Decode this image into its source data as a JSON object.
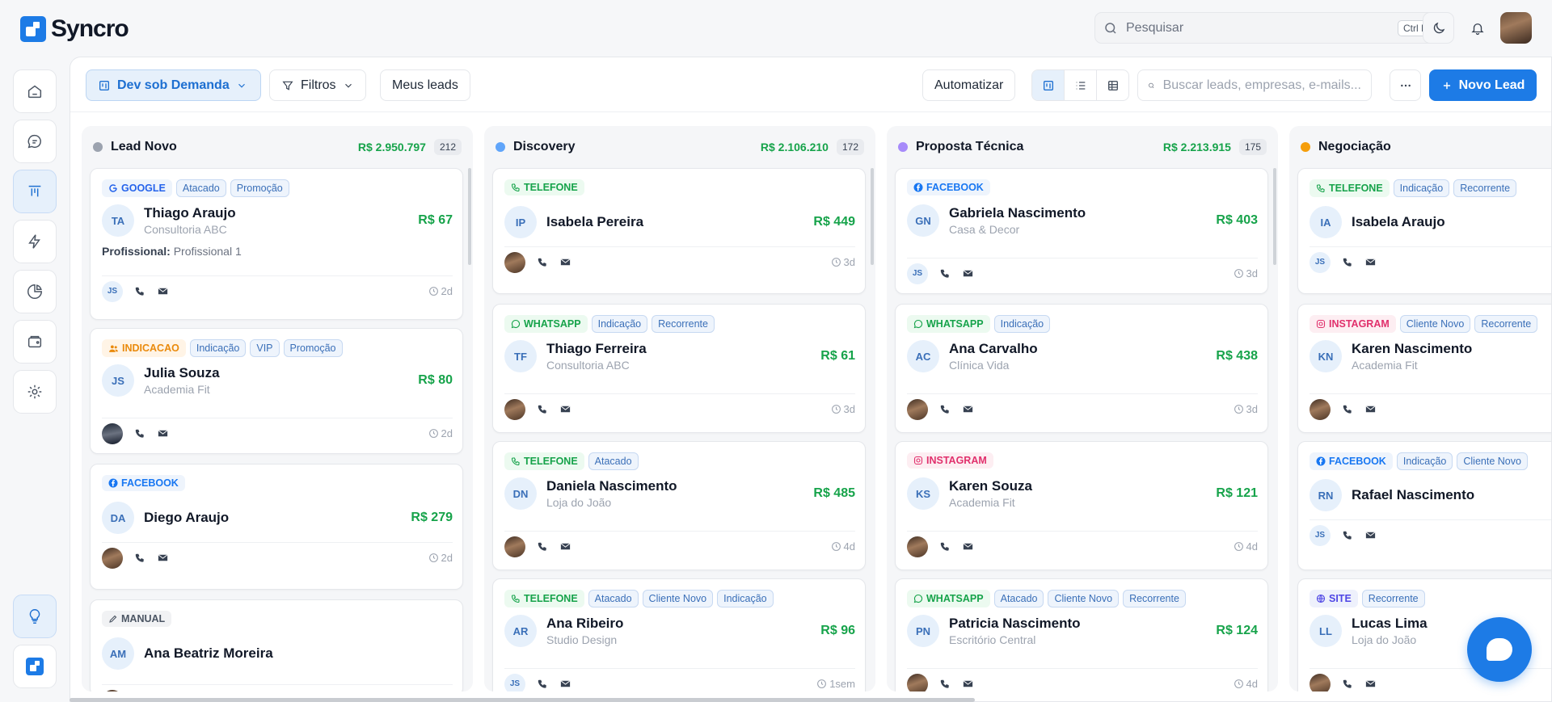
{
  "app": {
    "name": "Syncro"
  },
  "topbar": {
    "search_placeholder": "Pesquisar",
    "shortcut": "Ctrl K"
  },
  "toolbar": {
    "pipeline": "Dev sob Demanda",
    "filters": "Filtros",
    "my_leads": "Meus leads",
    "automate": "Automatizar",
    "search_placeholder": "Buscar leads, empresas, e-mails...",
    "new_lead": "Novo Lead"
  },
  "colors": {
    "accent": "#1d7be6",
    "money": "#16a34a"
  },
  "columns": [
    {
      "title": "Lead Novo",
      "total": "R$ 2.950.797",
      "count": "212",
      "dot": "#9ca3af",
      "cards": [
        {
          "source": "GOOGLE",
          "src_class": "google",
          "tags": [
            "Atacado",
            "Promoção"
          ],
          "initials": "TA",
          "name": "Thiago Araujo",
          "company": "Consultoria ABC",
          "value": "R$ 67",
          "extra_label": "Profissional:",
          "extra_value": "Profissional 1",
          "owner": "JS",
          "ago": "2d"
        },
        {
          "source": "INDICACAO",
          "src_class": "indicacao",
          "tags": [
            "Indicação",
            "VIP",
            "Promoção"
          ],
          "initials": "JS",
          "name": "Julia Souza",
          "company": "Academia Fit",
          "value": "R$ 80",
          "owner": "",
          "ago": "2d"
        },
        {
          "source": "FACEBOOK",
          "src_class": "facebook",
          "tags": [],
          "initials": "DA",
          "name": "Diego Araujo",
          "company": "",
          "value": "R$ 279",
          "owner": "",
          "ago": "2d"
        },
        {
          "source": "MANUAL",
          "src_class": "manual",
          "tags": [],
          "initials": "AM",
          "name": "Ana Beatriz Moreira",
          "company": "",
          "value": "",
          "owner": "",
          "ago": ""
        }
      ]
    },
    {
      "title": "Discovery",
      "total": "R$ 2.106.210",
      "count": "172",
      "dot": "#60a5fa",
      "cards": [
        {
          "source": "TELEFONE",
          "src_class": "telefone",
          "tags": [],
          "initials": "IP",
          "name": "Isabela Pereira",
          "company": "",
          "value": "R$ 449",
          "owner": "",
          "ago": "3d"
        },
        {
          "source": "WHATSAPP",
          "src_class": "whatsapp",
          "tags": [
            "Indicação",
            "Recorrente"
          ],
          "initials": "TF",
          "name": "Thiago Ferreira",
          "company": "Consultoria ABC",
          "value": "R$ 61",
          "owner": "",
          "ago": "3d"
        },
        {
          "source": "TELEFONE",
          "src_class": "telefone",
          "tags": [
            "Atacado"
          ],
          "initials": "DN",
          "name": "Daniela Nascimento",
          "company": "Loja do João",
          "value": "R$ 485",
          "owner": "",
          "ago": "4d"
        },
        {
          "source": "TELEFONE",
          "src_class": "telefone",
          "tags": [
            "Atacado",
            "Cliente Novo",
            "Indicação"
          ],
          "initials": "AR",
          "name": "Ana Ribeiro",
          "company": "Studio Design",
          "value": "R$ 96",
          "owner": "JS",
          "ago": "1sem"
        }
      ]
    },
    {
      "title": "Proposta Técnica",
      "total": "R$ 2.213.915",
      "count": "175",
      "dot": "#a78bfa",
      "cards": [
        {
          "source": "FACEBOOK",
          "src_class": "facebook",
          "tags": [],
          "initials": "GN",
          "name": "Gabriela Nascimento",
          "company": "Casa & Decor",
          "value": "R$ 403",
          "owner": "JS",
          "ago": "3d"
        },
        {
          "source": "WHATSAPP",
          "src_class": "whatsapp",
          "tags": [
            "Indicação"
          ],
          "initials": "AC",
          "name": "Ana Carvalho",
          "company": "Clínica Vida",
          "value": "R$ 438",
          "owner": "",
          "ago": "3d"
        },
        {
          "source": "INSTAGRAM",
          "src_class": "instagram",
          "tags": [],
          "initials": "KS",
          "name": "Karen Souza",
          "company": "Academia Fit",
          "value": "R$ 121",
          "owner": "",
          "ago": "4d"
        },
        {
          "source": "WHATSAPP",
          "src_class": "whatsapp",
          "tags": [
            "Atacado",
            "Cliente Novo",
            "Recorrente"
          ],
          "initials": "PN",
          "name": "Patricia Nascimento",
          "company": "Escritório Central",
          "value": "R$ 124",
          "owner": "",
          "ago": "4d"
        }
      ]
    },
    {
      "title": "Negociação",
      "total": "",
      "count": "",
      "dot": "#f59e0b",
      "cards": [
        {
          "source": "TELEFONE",
          "src_class": "telefone",
          "tags": [
            "Indicação",
            "Recorrente"
          ],
          "initials": "IA",
          "name": "Isabela Araujo",
          "company": "",
          "value": "",
          "owner": "JS",
          "ago": ""
        },
        {
          "source": "INSTAGRAM",
          "src_class": "instagram",
          "tags": [
            "Cliente Novo",
            "Recorrente"
          ],
          "initials": "KN",
          "name": "Karen Nascimento",
          "company": "Academia Fit",
          "value": "",
          "owner": "",
          "ago": ""
        },
        {
          "source": "FACEBOOK",
          "src_class": "facebook",
          "tags": [
            "Indicação",
            "Cliente Novo"
          ],
          "initials": "RN",
          "name": "Rafael Nascimento",
          "company": "",
          "value": "",
          "owner": "JS",
          "ago": ""
        },
        {
          "source": "SITE",
          "src_class": "site",
          "tags": [
            "Recorrente"
          ],
          "initials": "LL",
          "name": "Lucas Lima",
          "company": "Loja do João",
          "value": "",
          "owner": "",
          "ago": ""
        }
      ]
    }
  ]
}
